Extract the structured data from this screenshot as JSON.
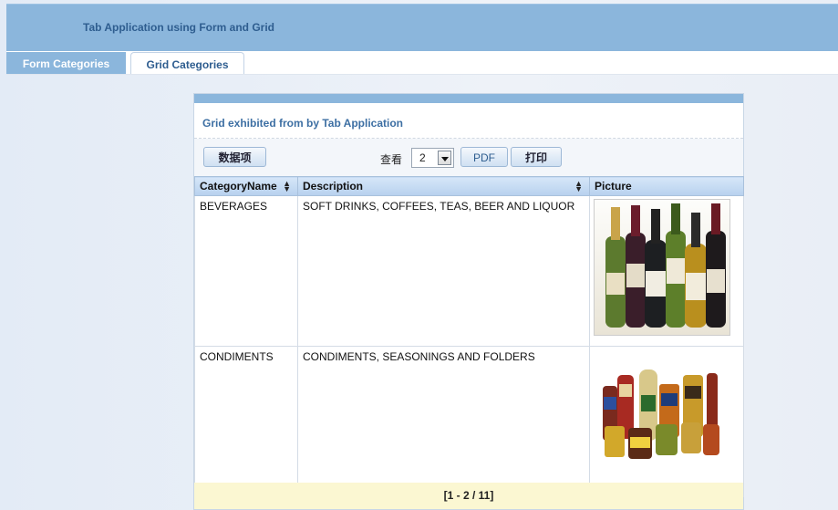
{
  "app": {
    "title": "Tab Application using Form and Grid"
  },
  "tabs": [
    {
      "label": "Form Categories",
      "active": true
    },
    {
      "label": "Grid Categories",
      "active": false
    }
  ],
  "panel": {
    "title": "Grid exhibited from by Tab Application"
  },
  "toolbar": {
    "data_items_label": "数据项",
    "view_label": "查看",
    "page_size": "2",
    "pdf_label": "PDF",
    "print_label": "打印"
  },
  "grid": {
    "columns": [
      "CategoryName",
      "Description",
      "Picture"
    ],
    "rows": [
      {
        "category": "BEVERAGES",
        "description": "SOFT DRINKS, COFFEES, TEAS, BEER AND LIQUOR",
        "picture": "wine-bottles-image"
      },
      {
        "category": "CONDIMENTS",
        "description": "CONDIMENTS, SEASONINGS AND FOLDERS",
        "picture": "condiment-jars-image"
      }
    ]
  },
  "pager": {
    "text": "[1 - 2 / 11]"
  },
  "colors": {
    "header": "#8bb6dc",
    "accent": "#2e5d8f",
    "pager_bg": "#fbf7d2"
  }
}
